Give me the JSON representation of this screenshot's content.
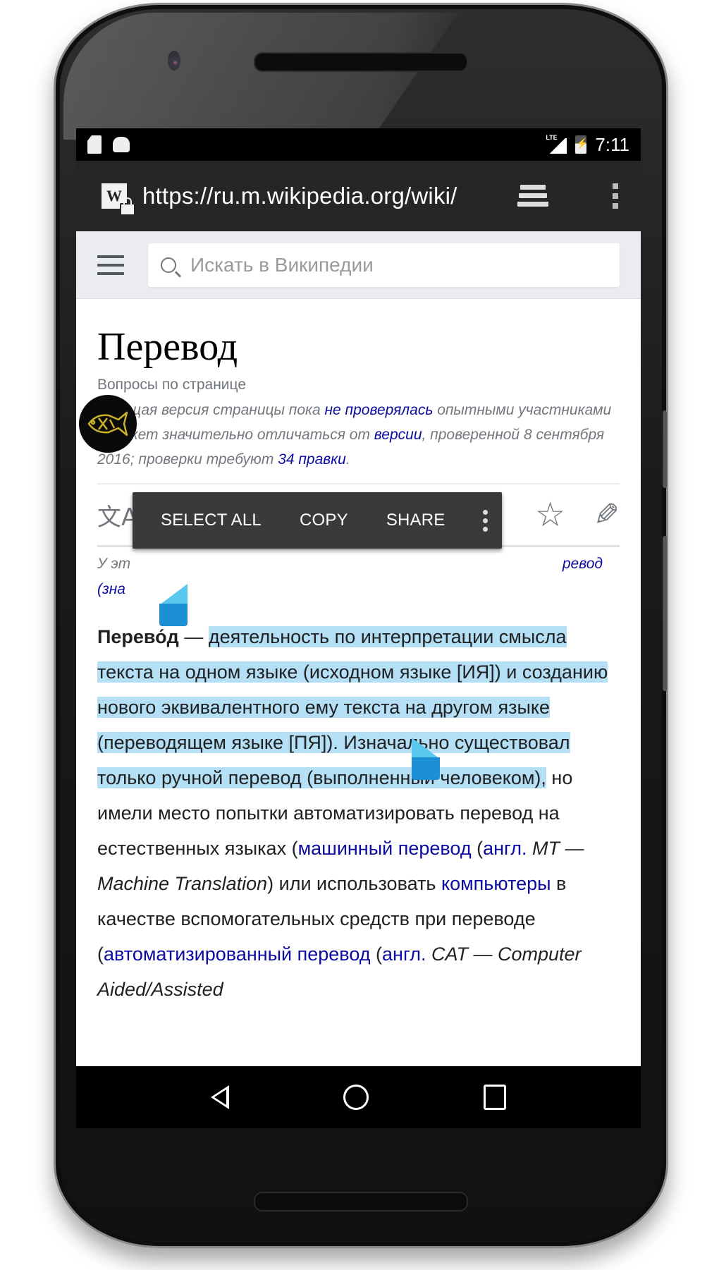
{
  "status_bar": {
    "time": "7:11",
    "network_label": "LTE",
    "left_icons": [
      "sd-card-icon",
      "android-debug-icon"
    ],
    "right_icons": [
      "lte-signal-icon",
      "battery-charging-icon"
    ]
  },
  "browser": {
    "url": "https://ru.m.wikipedia.org/wiki/",
    "site_icon_letter": "W",
    "icons": [
      "site-lock-icon",
      "tabs-icon",
      "overflow-menu-icon"
    ]
  },
  "wiki_header": {
    "search_placeholder": "Искать в Википедии"
  },
  "article": {
    "title": "Перевод",
    "issues_link": "Вопросы по странице",
    "notice": {
      "part1": "Текущая версия страницы пока ",
      "link1": "не проверялась",
      "part2": " опытными участниками и может значительно отличаться от ",
      "link2": "версии",
      "part3": ", проверенной 8 сентября 2016; проверки требуют ",
      "link3": "34 правки",
      "part4": "."
    },
    "hatnote": {
      "visible_start": "У эт",
      "visible_end_link": "ревод",
      "line2_start": "(зна"
    },
    "lead": {
      "term": "Перево́д",
      "dash": " — ",
      "selected": "деятельность по интерпретации смысла текста на одном языке (исходном языке [ИЯ]) и созданию нового эквивалентного ему текста на другом языке (переводящем языке [ПЯ]). Изначально существовал только ручной перевод (выполненный человеком),",
      "t1": " но имели место попытки автоматизировать перевод на естественных языках (",
      "l1": "машинный перевод",
      "t2": " (",
      "l2": "англ.",
      "i1": " MT — Machine Translation",
      "t3": ") или использовать ",
      "l3": "компьютеры",
      "t4": " в качестве вспомогательных средств при переводе (",
      "l4": "автоматизированный перевод",
      "t5": " (",
      "l5": "англ.",
      "i2": " CAT — Computer Aided/Assisted"
    }
  },
  "selection_menu": {
    "select_all": "SELECT ALL",
    "copy": "COPY",
    "share": "SHARE"
  },
  "colors": {
    "link": "#0b0ba0",
    "selection": "#b4dff5",
    "handle": "#1d8fd4",
    "popup_bg": "#3a3a3a"
  }
}
